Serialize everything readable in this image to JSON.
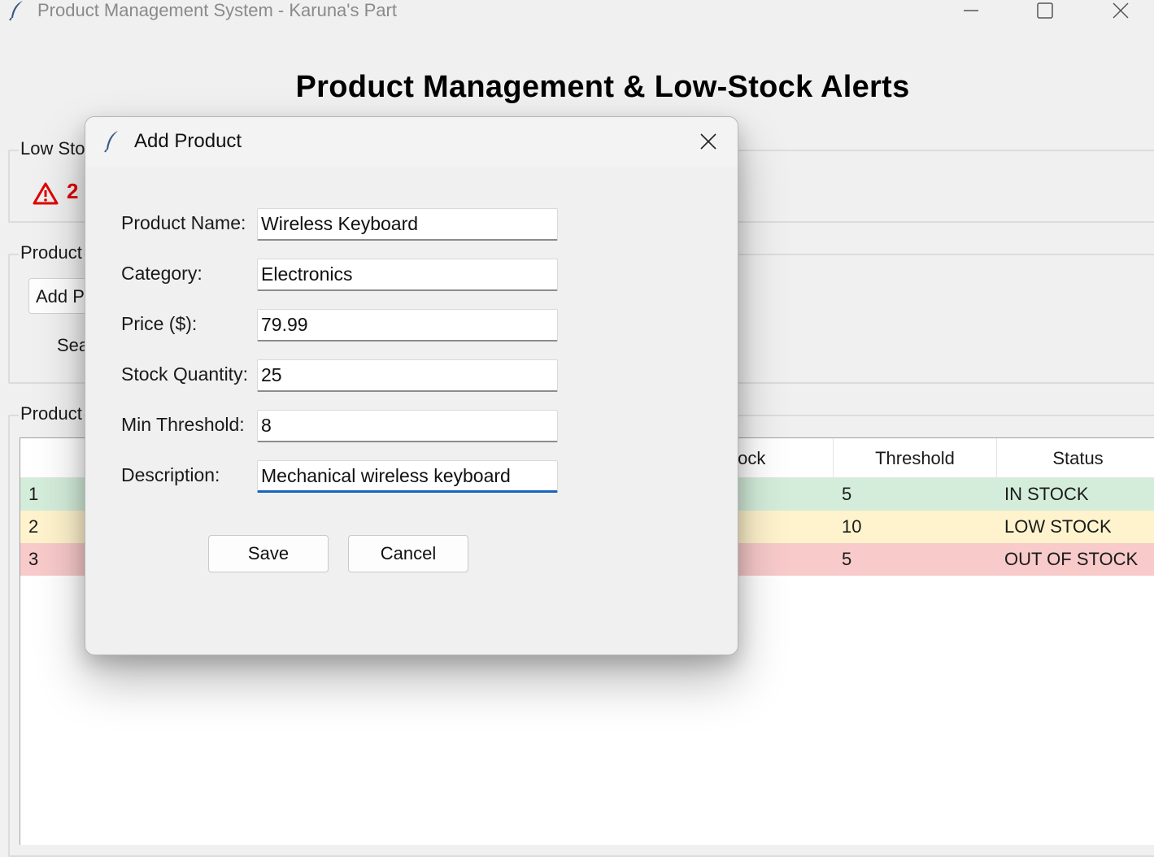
{
  "window": {
    "title": "Product Management System - Karuna's Part"
  },
  "app": {
    "heading": "Product Management & Low-Stock Alerts"
  },
  "low_stock_frame": {
    "label": "Low Sto",
    "alert_count": "2",
    "alert_color": "#e00000"
  },
  "operations_frame": {
    "label": "Product",
    "add_button_label": "Add P",
    "search_label": "Sea"
  },
  "list_frame": {
    "label": "Product"
  },
  "table": {
    "columns": [
      "tock",
      "Threshold",
      "Status"
    ],
    "rows": [
      {
        "id": "1",
        "threshold": "5",
        "status": "IN STOCK",
        "color": "#d4edda"
      },
      {
        "id": "2",
        "threshold": "10",
        "status": "LOW STOCK",
        "color": "#fff3cd"
      },
      {
        "id": "3",
        "threshold": "5",
        "status": "OUT OF STOCK",
        "color": "#f8caca"
      }
    ]
  },
  "dialog": {
    "title": "Add Product",
    "fields": {
      "name": {
        "label": "Product Name:",
        "value": "Wireless Keyboard"
      },
      "category": {
        "label": "Category:",
        "value": "Electronics"
      },
      "price": {
        "label": "Price ($):",
        "value": "79.99"
      },
      "stock": {
        "label": "Stock Quantity:",
        "value": "25"
      },
      "threshold": {
        "label": "Min Threshold:",
        "value": "8"
      },
      "description": {
        "label": "Description:",
        "value": "Mechanical wireless keyboard"
      }
    },
    "save_label": "Save",
    "cancel_label": "Cancel",
    "focus_color": "#1565c0"
  },
  "icons": {
    "app": "feather-icon",
    "minimize": "minimize-icon",
    "maximize": "maximize-icon",
    "close": "close-icon",
    "alert": "warning-icon"
  }
}
